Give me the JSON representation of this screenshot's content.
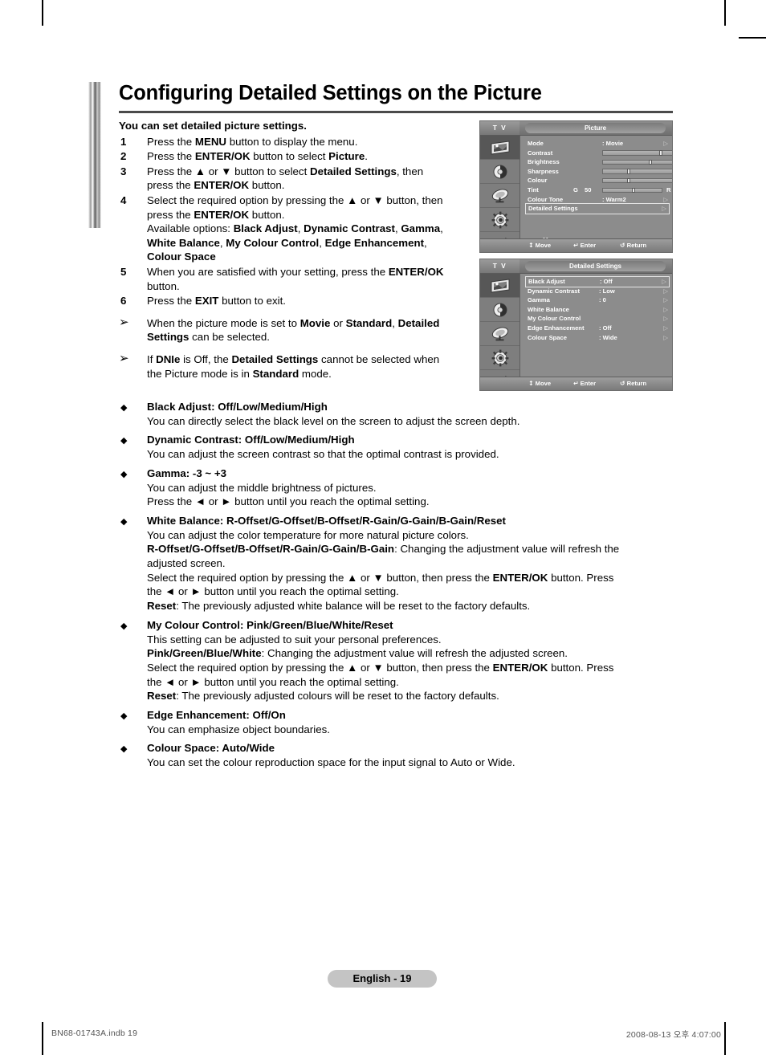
{
  "document": {
    "title": "Configuring Detailed Settings on the Picture",
    "lead": "You can set detailed picture settings.",
    "page_label": "English - 19",
    "print_footer_left": "BN68-01743A.indb   19",
    "print_footer_right": "2008-08-13   오후 4:07:00"
  },
  "steps": [
    {
      "num": "1",
      "lines": [
        [
          {
            "t": "Press the "
          },
          {
            "t": "MENU",
            "b": true
          },
          {
            "t": " button to display the menu."
          }
        ]
      ]
    },
    {
      "num": "2",
      "lines": [
        [
          {
            "t": "Press the "
          },
          {
            "t": "ENTER/OK",
            "b": true
          },
          {
            "t": " button to select "
          },
          {
            "t": "Picture",
            "b": true
          },
          {
            "t": "."
          }
        ]
      ]
    },
    {
      "num": "3",
      "lines": [
        [
          {
            "t": "Press the ▲ or ▼ button to select "
          },
          {
            "t": "Detailed Settings",
            "b": true
          },
          {
            "t": ", then"
          }
        ],
        [
          {
            "t": "press the "
          },
          {
            "t": "ENTER/OK",
            "b": true
          },
          {
            "t": " button."
          }
        ]
      ]
    },
    {
      "num": "4",
      "lines": [
        [
          {
            "t": "Select the required option by pressing the ▲ or ▼ button, then"
          }
        ],
        [
          {
            "t": "press the "
          },
          {
            "t": "ENTER/OK",
            "b": true
          },
          {
            "t": " button."
          }
        ],
        [
          {
            "t": "Available options: "
          },
          {
            "t": "Black Adjust",
            "b": true
          },
          {
            "t": ", "
          },
          {
            "t": "Dynamic Contrast",
            "b": true
          },
          {
            "t": ", "
          },
          {
            "t": "Gamma",
            "b": true
          },
          {
            "t": ","
          }
        ],
        [
          {
            "t": "White Balance",
            "b": true
          },
          {
            "t": ", "
          },
          {
            "t": "My Colour Control",
            "b": true
          },
          {
            "t": ", "
          },
          {
            "t": "Edge Enhancement",
            "b": true
          },
          {
            "t": ","
          }
        ],
        [
          {
            "t": "Colour Space",
            "b": true
          }
        ]
      ]
    },
    {
      "num": "5",
      "lines": [
        [
          {
            "t": "When you are satisfied with your setting, press the "
          },
          {
            "t": "ENTER/OK",
            "b": true
          }
        ],
        [
          {
            "t": "button."
          }
        ]
      ]
    },
    {
      "num": "6",
      "lines": [
        [
          {
            "t": "Press the "
          },
          {
            "t": "EXIT",
            "b": true
          },
          {
            "t": " button to exit."
          }
        ]
      ]
    }
  ],
  "notes": [
    {
      "marker": "➢",
      "lines": [
        [
          {
            "t": "When the picture mode is set to "
          },
          {
            "t": "Movie",
            "b": true
          },
          {
            "t": " or "
          },
          {
            "t": "Standard",
            "b": true
          },
          {
            "t": ", "
          },
          {
            "t": "Detailed",
            "b": true
          }
        ],
        [
          {
            "t": "Settings",
            "b": true
          },
          {
            "t": " can be selected."
          }
        ]
      ]
    },
    {
      "marker": "➢",
      "lines": [
        [
          {
            "t": "If "
          },
          {
            "t": "DNIe",
            "b": true
          },
          {
            "t": " is Off, the "
          },
          {
            "t": "Detailed Settings",
            "b": true
          },
          {
            "t": " cannot be selected when"
          }
        ],
        [
          {
            "t": "the Picture mode is in "
          },
          {
            "t": "Standard",
            "b": true
          },
          {
            "t": " mode."
          }
        ]
      ]
    }
  ],
  "bullets": [
    {
      "marker": "◆",
      "lines": [
        [
          {
            "t": "Black Adjust",
            "b": true
          },
          {
            "t": ": ",
            "b": true
          },
          {
            "t": "Off/Low/Medium/High",
            "b": true
          }
        ],
        [
          {
            "t": "You can directly select the black level on the screen to adjust the screen depth."
          }
        ]
      ]
    },
    {
      "marker": "◆",
      "lines": [
        [
          {
            "t": "Dynamic Contrast",
            "b": true
          },
          {
            "t": ": Off/Low/Medium/High",
            "b": true
          }
        ],
        [
          {
            "t": "You can adjust the screen contrast so that the optimal contrast is provided."
          }
        ]
      ]
    },
    {
      "marker": "◆",
      "lines": [
        [
          {
            "t": "Gamma",
            "b": true
          },
          {
            "t": ": -3 ~ +3",
            "b": true
          }
        ],
        [
          {
            "t": "You can adjust the middle brightness of pictures."
          }
        ],
        [
          {
            "t": "Press the ◄ or ► button until you reach the optimal setting."
          }
        ]
      ]
    },
    {
      "marker": "◆",
      "lines": [
        [
          {
            "t": "White Balance",
            "b": true
          },
          {
            "t": ": R-Offset/G-Offset/B-Offset/R-Gain/G-Gain/B-Gain/Reset",
            "b": true
          }
        ],
        [
          {
            "t": "You can adjust the color temperature for more natural picture colors."
          }
        ],
        [
          {
            "t": "R-Offset/G-Offset/B-Offset/R-Gain/G-Gain/B-Gain",
            "b": true
          },
          {
            "t": ": Changing the adjustment value will refresh the"
          }
        ],
        [
          {
            "t": "adjusted screen."
          }
        ],
        [
          {
            "t": "Select the required option by pressing the ▲ or ▼ button, then press the "
          },
          {
            "t": "ENTER/OK",
            "b": true
          },
          {
            "t": " button. Press"
          }
        ],
        [
          {
            "t": "the ◄ or ► button until you reach the optimal setting."
          }
        ],
        [
          {
            "t": "Reset",
            "b": true
          },
          {
            "t": ": The previously adjusted white balance will be reset to the factory defaults."
          }
        ]
      ]
    },
    {
      "marker": "◆",
      "lines": [
        [
          {
            "t": "My Colour Control",
            "b": true
          },
          {
            "t": ": Pink/Green/Blue/White/Reset",
            "b": true
          }
        ],
        [
          {
            "t": "This setting can be adjusted to suit your personal preferences."
          }
        ],
        [
          {
            "t": "Pink/Green/Blue/White",
            "b": true
          },
          {
            "t": ": Changing the adjustment value will refresh the adjusted screen."
          }
        ],
        [
          {
            "t": "Select the required option by pressing the ▲ or ▼ button, then press the "
          },
          {
            "t": "ENTER/OK",
            "b": true
          },
          {
            "t": " button. Press"
          }
        ],
        [
          {
            "t": "the ◄ or ► button until you reach the optimal setting."
          }
        ],
        [
          {
            "t": "Reset",
            "b": true
          },
          {
            "t": ": The previously adjusted colours will be reset to the factory defaults."
          }
        ]
      ]
    },
    {
      "marker": "◆",
      "lines": [
        [
          {
            "t": "Edge Enhancement",
            "b": true
          },
          {
            "t": ": Off/On",
            "b": true
          }
        ],
        [
          {
            "t": "You can emphasize object boundaries."
          }
        ]
      ]
    },
    {
      "marker": "◆",
      "lines": [
        [
          {
            "t": "Colour Space",
            "b": true
          },
          {
            "t": ": Auto/Wide",
            "b": true
          }
        ],
        [
          {
            "t": "You can set the colour reproduction space for the input signal to Auto or Wide."
          }
        ]
      ]
    }
  ],
  "osd_picture": {
    "source_label": "T V",
    "title": "Picture",
    "icons": [
      "picture-icon",
      "sound-icon",
      "channel-icon",
      "setup-icon",
      "input-icon"
    ],
    "selected_icon_index": 0,
    "rows": [
      {
        "label": "Mode",
        "value": ": Movie",
        "arrow": "▷",
        "type": "value"
      },
      {
        "label": "Contrast",
        "type": "slider",
        "number": "80",
        "pos": 80
      },
      {
        "label": "Brightness",
        "type": "slider",
        "number": "65",
        "pos": 65
      },
      {
        "label": "Sharpness",
        "type": "slider",
        "number": "35",
        "pos": 35
      },
      {
        "label": "Colour",
        "type": "slider",
        "number": "35",
        "pos": 35
      },
      {
        "label": "Tint",
        "type": "tint",
        "left_letter": "G",
        "left_value": "50",
        "right_letter": "R",
        "number": "50",
        "pos": 50
      },
      {
        "label": "Colour Tone",
        "value": ": Warm2",
        "arrow": "▷",
        "type": "value"
      },
      {
        "label": "Detailed Settings",
        "value": "",
        "arrow": "▷",
        "type": "value",
        "highlighted": true
      }
    ],
    "more_label": "More",
    "more_glyph": "▽",
    "footer": {
      "move_glyph": "↕",
      "move_label": "Move",
      "enter_glyph": "↵",
      "enter_label": "Enter",
      "return_glyph": "↺",
      "return_label": "Return"
    }
  },
  "osd_detailed": {
    "source_label": "T V",
    "title": "Detailed Settings",
    "icons": [
      "picture-icon",
      "sound-icon",
      "channel-icon",
      "setup-icon",
      "input-icon"
    ],
    "selected_icon_index": 0,
    "rows": [
      {
        "label": "Black Adjust",
        "value": ": Off",
        "arrow": "▷",
        "highlighted": true
      },
      {
        "label": "Dynamic Contrast",
        "value": ": Low",
        "arrow": "▷"
      },
      {
        "label": "Gamma",
        "value": ":   0",
        "arrow": "▷"
      },
      {
        "label": "White Balance",
        "value": "",
        "arrow": "▷"
      },
      {
        "label": "My Colour Control",
        "value": "",
        "arrow": "▷"
      },
      {
        "label": "Edge Enhancement",
        "value": ": Off",
        "arrow": "▷"
      },
      {
        "label": "Colour Space",
        "value": ": Wide",
        "arrow": "▷"
      }
    ],
    "footer": {
      "move_glyph": "↕",
      "move_label": "Move",
      "enter_glyph": "↵",
      "enter_label": "Enter",
      "return_glyph": "↺",
      "return_label": "Return"
    }
  }
}
